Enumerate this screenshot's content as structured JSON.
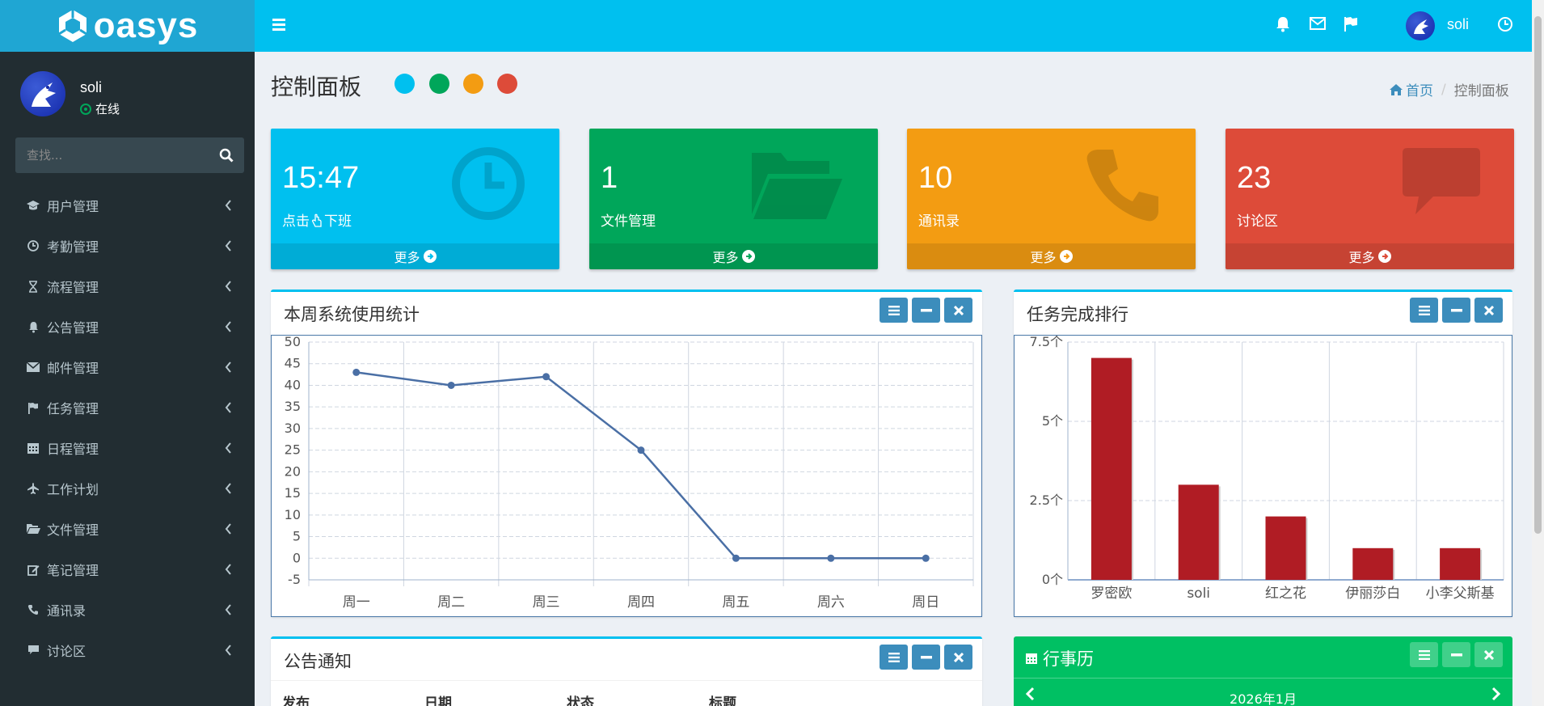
{
  "app": {
    "logo_text": "oasys"
  },
  "user": {
    "name": "soli",
    "status": "在线"
  },
  "sidebar": {
    "search_placeholder": "查找...",
    "items": [
      {
        "label": "用户管理",
        "icon": "graduation-cap-icon"
      },
      {
        "label": "考勤管理",
        "icon": "clock-icon"
      },
      {
        "label": "流程管理",
        "icon": "hourglass-icon"
      },
      {
        "label": "公告管理",
        "icon": "bell-icon"
      },
      {
        "label": "邮件管理",
        "icon": "envelope-icon"
      },
      {
        "label": "任务管理",
        "icon": "flag-icon"
      },
      {
        "label": "日程管理",
        "icon": "calendar-icon"
      },
      {
        "label": "工作计划",
        "icon": "plane-icon"
      },
      {
        "label": "文件管理",
        "icon": "folder-open-icon"
      },
      {
        "label": "笔记管理",
        "icon": "edit-icon"
      },
      {
        "label": "通讯录",
        "icon": "phone-icon"
      },
      {
        "label": "讨论区",
        "icon": "comment-icon"
      }
    ]
  },
  "header": {
    "user_name": "soli"
  },
  "page": {
    "title": "控制面板",
    "theme_swatches": [
      "#00c0ef",
      "#00a65a",
      "#f39c12",
      "#dd4b39"
    ],
    "breadcrumb": {
      "home": "首页",
      "current": "控制面板"
    }
  },
  "boxes": [
    {
      "value": "15:47",
      "label_pre": "点击",
      "label_post": "下班",
      "footer": "更多",
      "color": "#00c0ef",
      "icon": "clock-icon"
    },
    {
      "value": "1",
      "label": "文件管理",
      "footer": "更多",
      "color": "#00a65a",
      "icon": "folder-open-icon"
    },
    {
      "value": "10",
      "label": "通讯录",
      "footer": "更多",
      "color": "#f39c12",
      "icon": "phone-icon"
    },
    {
      "value": "23",
      "label": "讨论区",
      "footer": "更多",
      "color": "#dd4b39",
      "icon": "comment-icon"
    }
  ],
  "panels": {
    "usage": {
      "title": "本周系统使用统计"
    },
    "ranking": {
      "title": "任务完成排行"
    },
    "notice": {
      "title": "公告通知",
      "columns": [
        "发布",
        "日期",
        "状态",
        "标题"
      ]
    },
    "calendar": {
      "title": "行事历",
      "month": "2026年1月"
    }
  },
  "chart_data": [
    {
      "type": "line",
      "categories": [
        "周一",
        "周二",
        "周三",
        "周四",
        "周五",
        "周六",
        "周日"
      ],
      "values": [
        43,
        40,
        42,
        25,
        0,
        0,
        0
      ],
      "ylim": [
        -5,
        50
      ],
      "yticks": [
        50,
        45,
        40,
        35,
        30,
        25,
        20,
        15,
        10,
        5,
        0,
        -5
      ],
      "color": "#4a6fa5",
      "grid": true
    },
    {
      "type": "bar",
      "categories": [
        "罗密欧",
        "soli",
        "红之花",
        "伊丽莎白",
        "小李父斯基"
      ],
      "values": [
        7,
        3,
        2,
        1,
        1
      ],
      "ylim": [
        0,
        7.5
      ],
      "yticks": [
        "7.5个",
        "5个",
        "2.5个",
        "0个"
      ],
      "color": "#b01c24",
      "grid": true
    }
  ]
}
